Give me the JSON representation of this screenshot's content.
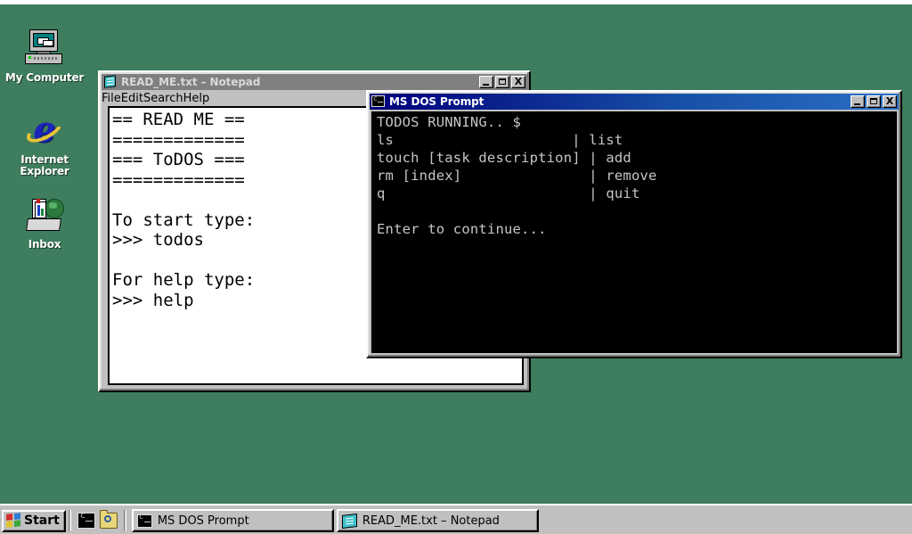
{
  "desktop": {
    "background_color": "#3e7d5d",
    "icons": [
      {
        "label": "My Computer",
        "icon": "my-computer-icon"
      },
      {
        "label": "Internet\nExplorer",
        "icon": "internet-explorer-icon"
      },
      {
        "label": "Inbox",
        "icon": "inbox-icon"
      }
    ]
  },
  "notepad": {
    "title": "READ_ME.txt – Notepad",
    "icon": "notepad-icon",
    "active": false,
    "menu": [
      "File",
      "Edit",
      "Search",
      "Help"
    ],
    "buttons": {
      "minimize": "-",
      "maximize": "□",
      "close": "X"
    },
    "content": "== READ ME ==\n=============\n=== ToDOS ===\n=============\n\nTo start type:\n>>> todos\n\nFor help type:\n>>> help"
  },
  "dos_prompt": {
    "title": "MS DOS Prompt",
    "icon": "ms-dos-icon",
    "active": true,
    "buttons": {
      "minimize": "-",
      "maximize": "□",
      "close": "X"
    },
    "content": "TODOS RUNNING.. $\nls                     | list\ntouch [task description] | add\nrm [index]               | remove\nq                        | quit\n\nEnter to continue...",
    "lines": [
      {
        "cmd": "TODOS RUNNING.. $",
        "desc": ""
      },
      {
        "cmd": "ls",
        "desc": "list"
      },
      {
        "cmd": "touch [task description]",
        "desc": "add"
      },
      {
        "cmd": "rm [index]",
        "desc": "remove"
      },
      {
        "cmd": "q",
        "desc": "quit"
      },
      {
        "cmd": "",
        "desc": ""
      },
      {
        "cmd": "Enter to continue...",
        "desc": ""
      }
    ],
    "foreground_color": "#c6c6c6",
    "background_color": "#000000"
  },
  "taskbar": {
    "start_label": "Start",
    "quick_launch": [
      {
        "icon": "ms-dos-icon"
      },
      {
        "icon": "find-folder-icon"
      }
    ],
    "tasks": [
      {
        "label": "MS DOS Prompt",
        "icon": "ms-dos-icon",
        "active": true
      },
      {
        "label": "READ_ME.txt – Notepad",
        "icon": "notepad-icon",
        "active": false
      }
    ]
  }
}
